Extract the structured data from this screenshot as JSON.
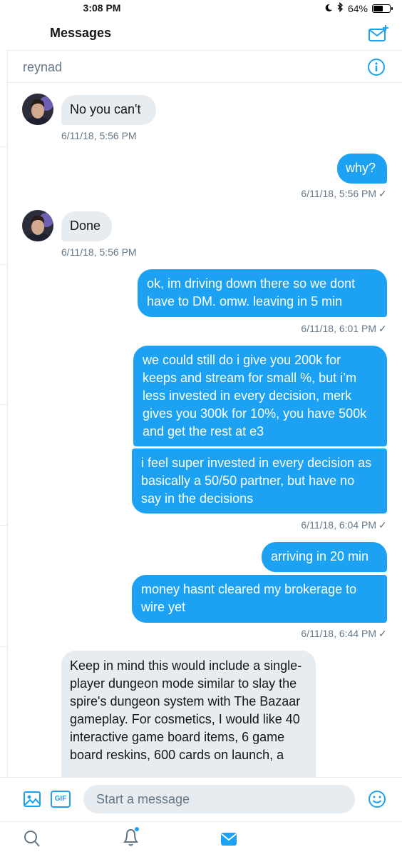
{
  "status": {
    "time": "3:08 PM",
    "battery_percent": "64%",
    "battery_level": 0.64
  },
  "header": {
    "title": "Messages"
  },
  "conversation": {
    "name": "reynad"
  },
  "messages": [
    {
      "direction": "in",
      "text": "No you can't",
      "timestamp": "6/11/18, 5:56 PM"
    },
    {
      "direction": "out",
      "text": "why?",
      "timestamp": "6/11/18, 5:56 PM"
    },
    {
      "direction": "in",
      "text": "Done",
      "timestamp": "6/11/18, 5:56 PM"
    },
    {
      "direction": "out",
      "text": "ok, im driving down there so we dont have to DM. omw. leaving in 5 min",
      "timestamp": "6/11/18, 6:01 PM"
    },
    {
      "direction": "out",
      "text": "we could still do i give you 200k for keeps and stream for small %, but i’m less invested in every decision, merk gives you 300k for 10%, you have 500k and get the rest at e3"
    },
    {
      "direction": "out",
      "text": "i feel super invested in every decision as basically a 50/50 partner, but have no say in the decisions",
      "timestamp": "6/11/18, 6:04 PM"
    },
    {
      "direction": "out",
      "text": "arriving in 20 min"
    },
    {
      "direction": "out",
      "text": "money hasnt cleared my brokerage to wire yet",
      "timestamp": "6/11/18, 6:44 PM"
    },
    {
      "direction": "in",
      "text": "Keep in mind this would include a single-player dungeon mode similar to slay the spire's dungeon system with The Bazaar gameplay. For cosmetics, I would like 40 interactive game board items, 6 game board reskins, 600 cards on launch, a"
    }
  ],
  "composer": {
    "placeholder": "Start a message",
    "gif_label": "GIF"
  },
  "colors": {
    "accent": "#1da1f2",
    "incoming_bubble": "#e6ecf0",
    "secondary_text": "#657786"
  },
  "icons": [
    "compose-message-icon",
    "info-icon",
    "image-icon",
    "gif-icon",
    "emoji-icon",
    "search-icon",
    "notifications-icon",
    "messages-icon",
    "read-checkmark-icon",
    "bluetooth-icon",
    "moon-icon"
  ]
}
